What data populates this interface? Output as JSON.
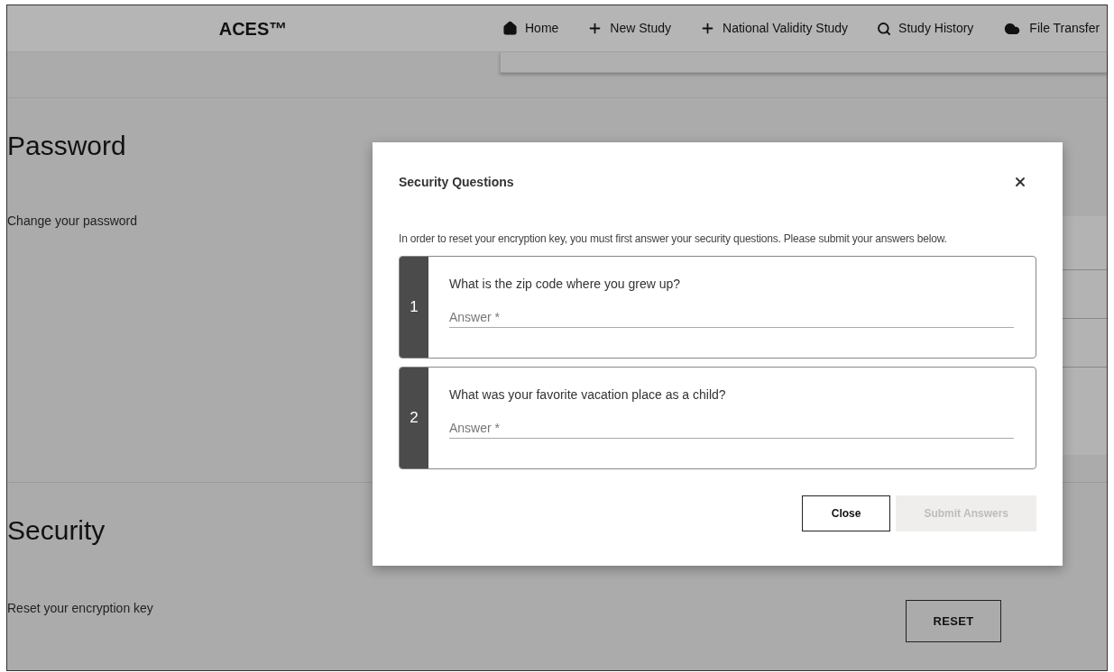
{
  "header": {
    "title": "ACES™",
    "nav": [
      {
        "kind": "home",
        "label": "Home"
      },
      {
        "kind": "add",
        "label": "New Study"
      },
      {
        "kind": "add",
        "label": "National Validity Study"
      },
      {
        "kind": "search",
        "label": "Study History"
      },
      {
        "kind": "cloud",
        "label": "File Transfer"
      }
    ]
  },
  "sections": [
    {
      "heading": "Password",
      "description": "Change your password"
    },
    {
      "heading": "Security",
      "description": "Reset your encryption key",
      "button": "RESET"
    }
  ],
  "dialog": {
    "title": "Security Questions",
    "intro": "In order to reset your encryption key, you must first answer your security questions. Please submit your answers below.",
    "questions": [
      {
        "number": "1",
        "text": "What is the zip code where you grew up?",
        "placeholder": "Answer *"
      },
      {
        "number": "2",
        "text": "What was your favorite vacation place as a child?",
        "placeholder": "Answer *"
      }
    ],
    "buttons": [
      {
        "label": "Close",
        "disabled": false
      },
      {
        "label": "Submit Answers",
        "disabled": true
      }
    ]
  }
}
